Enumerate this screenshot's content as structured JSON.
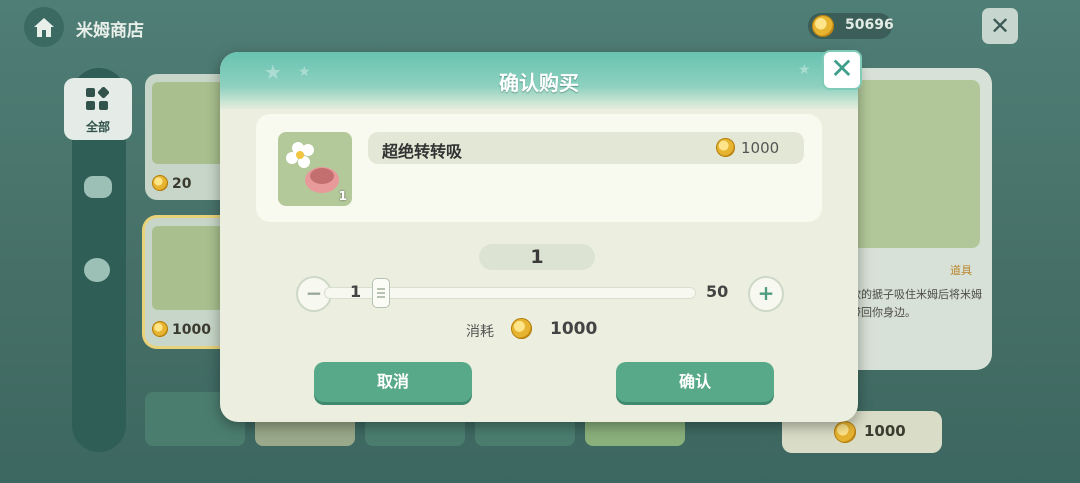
{
  "header": {
    "title": "米姆商店",
    "coins": "50696",
    "close": "✕"
  },
  "sidebar": {
    "all_label": "全部"
  },
  "grid": {
    "cards": [
      {
        "price": "20"
      },
      {
        "price": "1000"
      }
    ]
  },
  "detail": {
    "category": "道具",
    "description": "款的搋子吸住米姆后将米姆带回你身边。",
    "price": "1000"
  },
  "dialog": {
    "title": "确认购买",
    "close": "✕",
    "item": {
      "name": "超绝转转吸",
      "price": "1000",
      "quantity_badge": "1"
    },
    "quantity": "1",
    "slider": {
      "min": "1",
      "max": "50",
      "value": 1,
      "minus": "−",
      "plus": "+"
    },
    "cost": {
      "label": "消耗",
      "value": "1000"
    },
    "buttons": {
      "cancel": "取消",
      "confirm": "确认"
    }
  }
}
